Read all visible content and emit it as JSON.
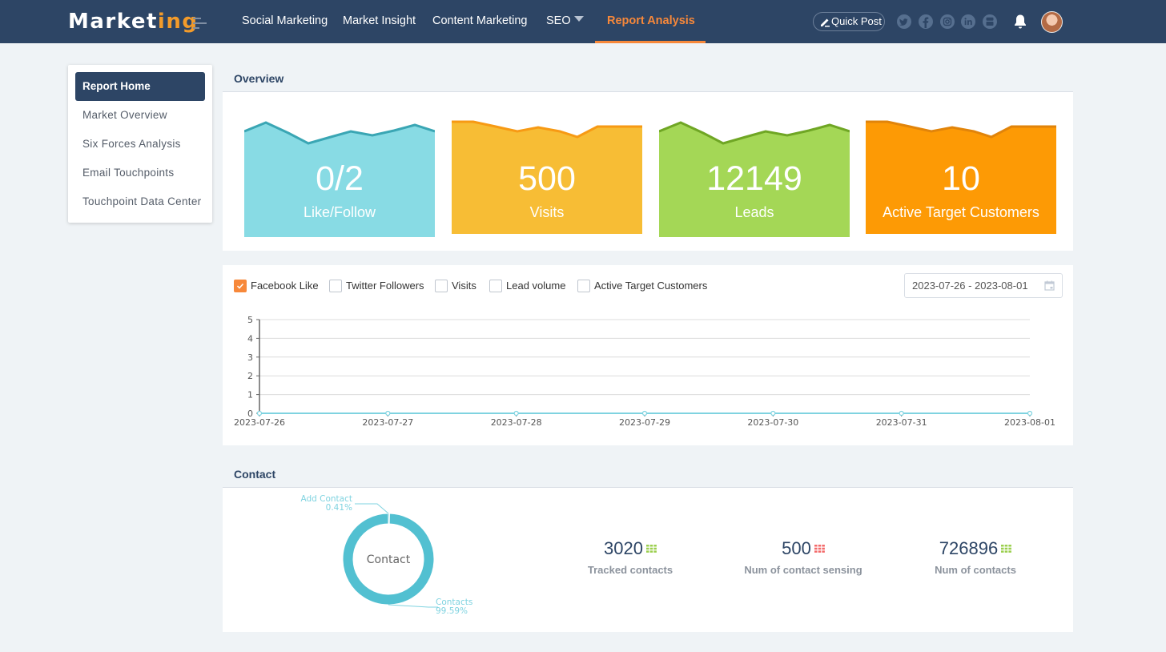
{
  "header": {
    "logo_main": "Market",
    "logo_accent": "ing",
    "nav": [
      {
        "label": "Social Marketing"
      },
      {
        "label": "Market Insight"
      },
      {
        "label": "Content Marketing"
      },
      {
        "label": "SEO",
        "has_dropdown": true
      },
      {
        "label": "Report Analysis",
        "active": true
      }
    ],
    "quick_post_label": "Quick Post",
    "social_icons": [
      "twitter-icon",
      "facebook-icon",
      "instagram-icon",
      "linkedin-icon",
      "youtube-icon"
    ],
    "accent_color": "#f7883a",
    "nav_bg_color": "#2d4565"
  },
  "sidebar": {
    "items": [
      {
        "label": "Report Home",
        "active": true
      },
      {
        "label": "Market Overview"
      },
      {
        "label": "Six Forces Analysis"
      },
      {
        "label": "Email Touchpoints"
      },
      {
        "label": "Touchpoint Data Center"
      }
    ]
  },
  "overview": {
    "title": "Overview",
    "cards": [
      {
        "value": "0/2",
        "label": "Like/Follow",
        "color": "#88dbe4",
        "line_color": "#3aa6b4"
      },
      {
        "value": "500",
        "label": "Visits",
        "color": "#f7bd35",
        "line_color": "#f79a14"
      },
      {
        "value": "12149",
        "label": "Leads",
        "color": "#a4d756",
        "line_color": "#6fa624"
      },
      {
        "value": "10",
        "label": "Active Target Customers",
        "color": "#fd9a05",
        "line_color": "#e1840a"
      }
    ]
  },
  "trend": {
    "filters": [
      {
        "label": "Facebook Like",
        "checked": true
      },
      {
        "label": "Twitter Followers",
        "checked": false
      },
      {
        "label": "Visits",
        "checked": false
      },
      {
        "label": "Lead volume",
        "checked": false
      },
      {
        "label": "Active Target Customers",
        "checked": false
      }
    ],
    "date_range": "2023-07-26 - 2023-08-01"
  },
  "chart_data": {
    "type": "line",
    "title": "",
    "xlabel": "",
    "ylabel": "",
    "x": [
      "2023-07-26",
      "2023-07-27",
      "2023-07-28",
      "2023-07-29",
      "2023-07-30",
      "2023-07-31",
      "2023-08-01"
    ],
    "yticks": [
      "0",
      "1",
      "2",
      "3",
      "4",
      "5"
    ],
    "ylim": [
      0,
      5
    ],
    "grid": true,
    "series": [
      {
        "name": "Facebook Like",
        "color": "#7fd3e0",
        "values": [
          0,
          0,
          0,
          0,
          0,
          0,
          0
        ]
      }
    ]
  },
  "contact": {
    "title": "Contact",
    "donut": {
      "center_label": "Contact",
      "color": "#52c0d1",
      "slices": [
        {
          "name": "Add Contact",
          "percent_label": "0.41%",
          "value": 0.41
        },
        {
          "name": "Contacts",
          "percent_label": "99.59%",
          "value": 99.59
        }
      ]
    },
    "stats": [
      {
        "value": "3020",
        "label": "Tracked contacts",
        "icon_color": "#9bcf4e"
      },
      {
        "value": "500",
        "label": "Num of contact sensing",
        "icon_color": "#f36a6a"
      },
      {
        "value": "726896",
        "label": "Num of contacts",
        "icon_color": "#9bcf4e"
      }
    ]
  }
}
